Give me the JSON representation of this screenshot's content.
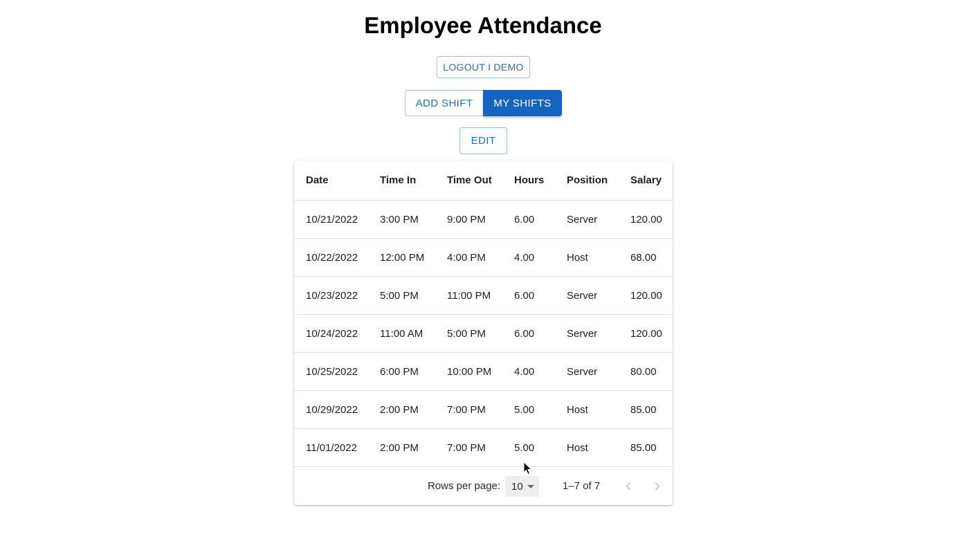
{
  "page": {
    "title": "Employee Attendance"
  },
  "actions": {
    "logout_label": "LOGOUT I DEMO",
    "add_shift_label": "ADD SHIFT",
    "my_shifts_label": "MY SHIFTS",
    "edit_label": "EDIT"
  },
  "table": {
    "columns": [
      "Date",
      "Time In",
      "Time Out",
      "Hours",
      "Position",
      "Salary"
    ],
    "rows": [
      [
        "10/21/2022",
        "3:00 PM",
        "9:00 PM",
        "6.00",
        "Server",
        "120.00"
      ],
      [
        "10/22/2022",
        "12:00 PM",
        "4:00 PM",
        "4.00",
        "Host",
        "68.00"
      ],
      [
        "10/23/2022",
        "5:00 PM",
        "11:00 PM",
        "6.00",
        "Server",
        "120.00"
      ],
      [
        "10/24/2022",
        "11:00 AM",
        "5:00 PM",
        "6.00",
        "Server",
        "120.00"
      ],
      [
        "10/25/2022",
        "6:00 PM",
        "10:00 PM",
        "4.00",
        "Server",
        "80.00"
      ],
      [
        "10/29/2022",
        "2:00 PM",
        "7:00 PM",
        "5.00",
        "Host",
        "85.00"
      ],
      [
        "11/01/2022",
        "2:00 PM",
        "7:00 PM",
        "5.00",
        "Host",
        "85.00"
      ]
    ]
  },
  "pagination": {
    "rows_per_page_label": "Rows per page:",
    "rows_per_page_value": "10",
    "range_text": "1–7 of 7",
    "prev_icon": "chevron-left-icon",
    "next_icon": "chevron-right-icon"
  },
  "colors": {
    "primary": "#1565c0",
    "outline_border": "#9cc0e3",
    "outline_text": "#1f6fc0"
  }
}
